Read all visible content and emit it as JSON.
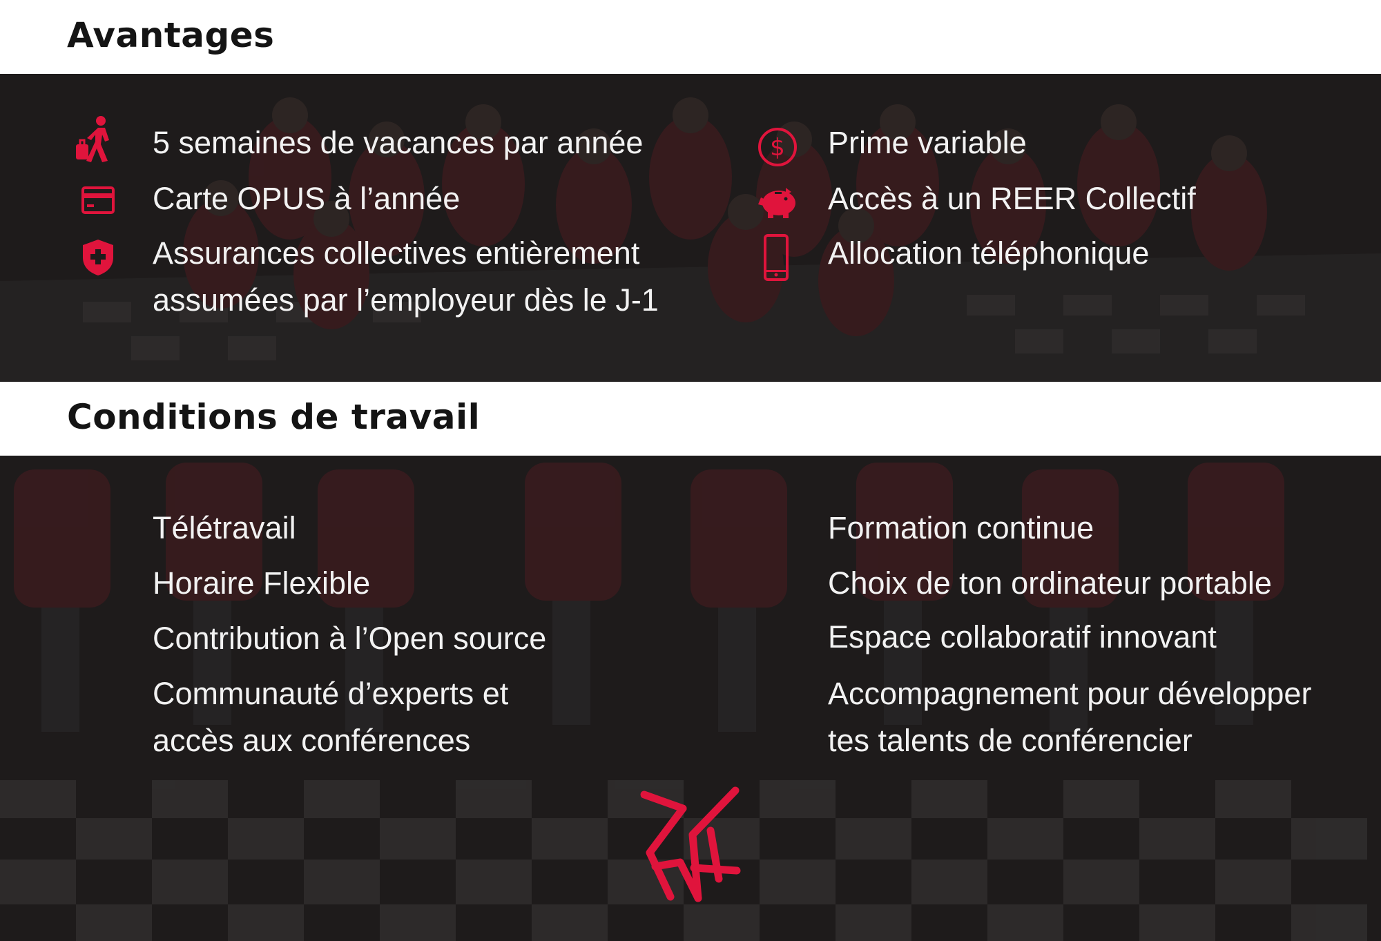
{
  "sections": {
    "advantages": {
      "title": "Avantages",
      "left": [
        {
          "icon": "person-walking-luggage-icon",
          "text": "5 semaines de vacances par année"
        },
        {
          "icon": "credit-card-icon",
          "text": "Carte OPUS à l’année"
        },
        {
          "icon": "shield-plus-icon",
          "line1": "Assurances collectives entièrement",
          "line2": "assumées par l’employeur dès le J-1"
        }
      ],
      "right": [
        {
          "icon": "dollar-circle-icon",
          "text": "Prime variable"
        },
        {
          "icon": "piggy-bank-icon",
          "text": "Accès à un REER Collectif"
        },
        {
          "icon": "smartphone-icon",
          "text": "Allocation téléphonique"
        }
      ]
    },
    "conditions": {
      "title": "Conditions de travail",
      "left": [
        {
          "text": "Télétravail"
        },
        {
          "text": "Horaire Flexible"
        },
        {
          "text": "Contribution à l’Open source"
        },
        {
          "line1": "Communauté d’experts et",
          "line2": "accès aux conférences"
        }
      ],
      "right": [
        {
          "text": "Formation continue"
        },
        {
          "text": "Choix de ton ordinateur portable"
        },
        {
          "text": "Espace collaboratif innovant"
        },
        {
          "line1": "Accompagnement pour développer",
          "line2": "tes talents de conférencier"
        }
      ]
    }
  },
  "logo": {
    "icon": "brand-monogram-logo"
  },
  "colors": {
    "accent": "#e0143c",
    "text": "#f2f2f2",
    "title": "#141414",
    "overlay": "#1c1a1a"
  }
}
